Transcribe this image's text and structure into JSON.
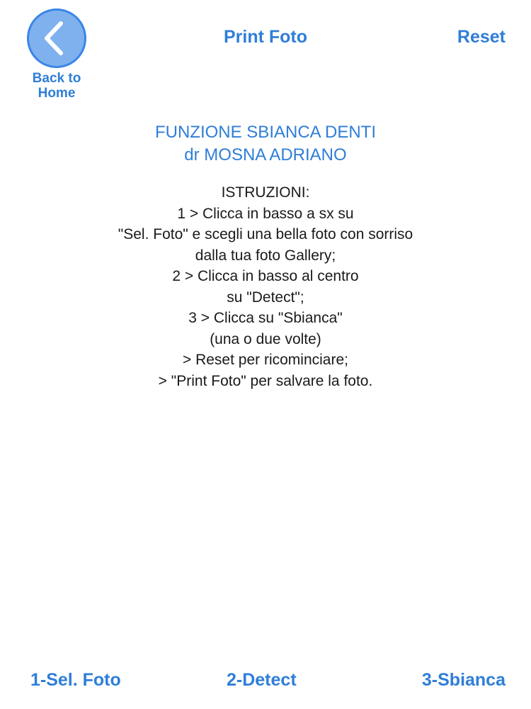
{
  "nav": {
    "back_label": "Back to\nHome",
    "title_action": "Print Foto",
    "reset_label": "Reset"
  },
  "heading": {
    "line1": "FUNZIONE SBIANCA DENTI",
    "line2": "dr MOSNA ADRIANO"
  },
  "instructions": [
    "ISTRUZIONI:",
    "1 > Clicca in basso a sx su",
    "\"Sel. Foto\" e scegli una bella foto con sorriso",
    "dalla tua foto Gallery;",
    "2 > Clicca in basso al centro",
    "su \"Detect\";",
    "3 > Clicca su \"Sbianca\"",
    "(una o due volte)",
    "> Reset per ricominciare;",
    "> \"Print Foto\" per salvare la foto."
  ],
  "toolbar": {
    "select_label": "1-Sel. Foto",
    "detect_label": "2-Detect",
    "whiten_label": "3-Sbianca"
  },
  "colors": {
    "accent": "#2f7ed8",
    "back_button_fill": "#7fb1ee",
    "text": "#1a1a1a"
  },
  "icons": {
    "back": "chevron-left-icon"
  }
}
